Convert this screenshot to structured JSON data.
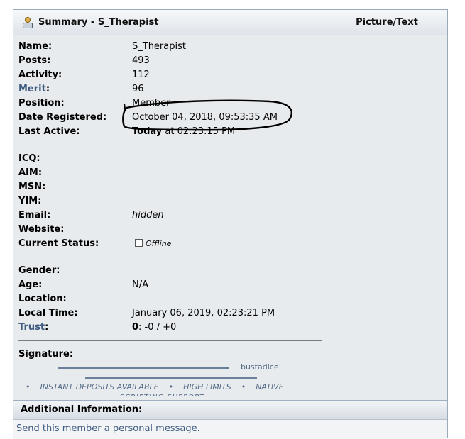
{
  "summary": {
    "header": "Summary - S_Therapist",
    "picture_header": "Picture/Text",
    "fields": [
      {
        "label": "Name:",
        "value": "S_Therapist"
      },
      {
        "label": "Posts:",
        "value": "493"
      },
      {
        "label": "Activity:",
        "value": "112"
      },
      {
        "label": "Merit",
        "label_suffix": ":",
        "value": "96"
      },
      {
        "label": "Position:",
        "value": "Member"
      },
      {
        "label": "Date Registered:",
        "value": "October 04, 2018, 09:53:35 AM"
      },
      {
        "label": "Last Active:",
        "value_bold": "Today",
        "value": " at 02:23:15 PM"
      }
    ],
    "contact": [
      {
        "label": "ICQ:",
        "value": ""
      },
      {
        "label": "AIM:",
        "value": ""
      },
      {
        "label": "MSN:",
        "value": ""
      },
      {
        "label": "YIM:",
        "value": ""
      },
      {
        "label": "Email:",
        "value": "hidden"
      },
      {
        "label": "Website:",
        "value": ""
      },
      {
        "label": "Current Status:",
        "value": "Offline"
      }
    ],
    "personal": [
      {
        "label": "Gender:",
        "value": ""
      },
      {
        "label": "Age:",
        "value": "N/A"
      },
      {
        "label": "Location:",
        "value": ""
      },
      {
        "label": "Local Time:",
        "value": "January 06, 2019, 02:23:21 PM"
      },
      {
        "label": "Trust",
        "label_suffix": ":",
        "value_bold": "0",
        "value": ": -0 / +0"
      }
    ],
    "signature": {
      "label": "Signature:",
      "brand": "bustadice",
      "features": [
        "INSTANT DEPOSITS AVAILABLE",
        "HIGH LIMITS",
        "NATIVE"
      ],
      "cut_text": "SCRIPTING SUPPORT"
    }
  },
  "additional": {
    "header": "Additional Information:",
    "pm_link": "Send this member a personal message."
  },
  "colors": {
    "link": "#3e5a80",
    "header_bg": "#dfe4ea",
    "page_bg": "#e8ebee",
    "annotation_ink": "#000000"
  },
  "icons": {
    "profile": "profile-icon",
    "status": "offline-status-icon"
  }
}
